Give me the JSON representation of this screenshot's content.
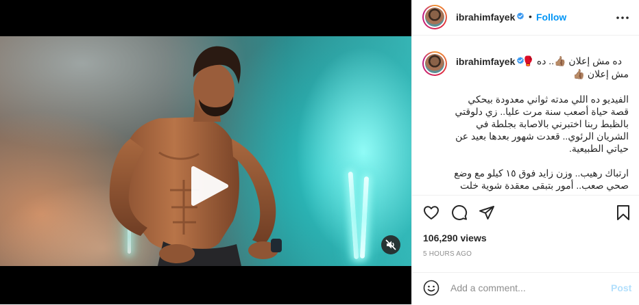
{
  "post": {
    "username": "ibrahimfayek",
    "follow_label": "Follow",
    "separator": "•"
  },
  "caption": {
    "username": "ibrahimfayek",
    "lines": [
      "ده مش إعلان 👍🏽.. ده 🥊",
      "مش إعلان 👍🏽",
      "الفيديو ده اللي مدته ثواني معدودة بيحكي\nقصة حياة أصعب سنة مرت عليا.. زي دلوقتي\nبالظبط ربنا اختبرني بالاصابة بجلطة في\nالشريان الرئوي.. قعدت شهور بعدها بعيد عن\nحياتي الطبيعية.",
      "ارتباك رهيب.. وزن زايد فوق ١٥ كيلو مع وضع\nصحي صعب.. أمور بتبقى معقدة شوية خلت"
    ]
  },
  "stats": {
    "views": "106,290 views",
    "time": "5 HOURS AGO"
  },
  "comment": {
    "placeholder": "Add a comment...",
    "post_label": "Post"
  },
  "icons": {
    "verified": "verified-badge-icon",
    "more": "more-options-icon",
    "like": "heart-icon",
    "comment": "comment-icon",
    "share": "share-icon",
    "save": "bookmark-icon",
    "emoji": "smiley-icon",
    "play": "play-icon",
    "mute": "muted-speaker-icon"
  },
  "colors": {
    "accent": "#0095f6",
    "verified": "#3897f0",
    "muted_text": "#8e8e8e",
    "post_disabled": "#b2dffc"
  }
}
